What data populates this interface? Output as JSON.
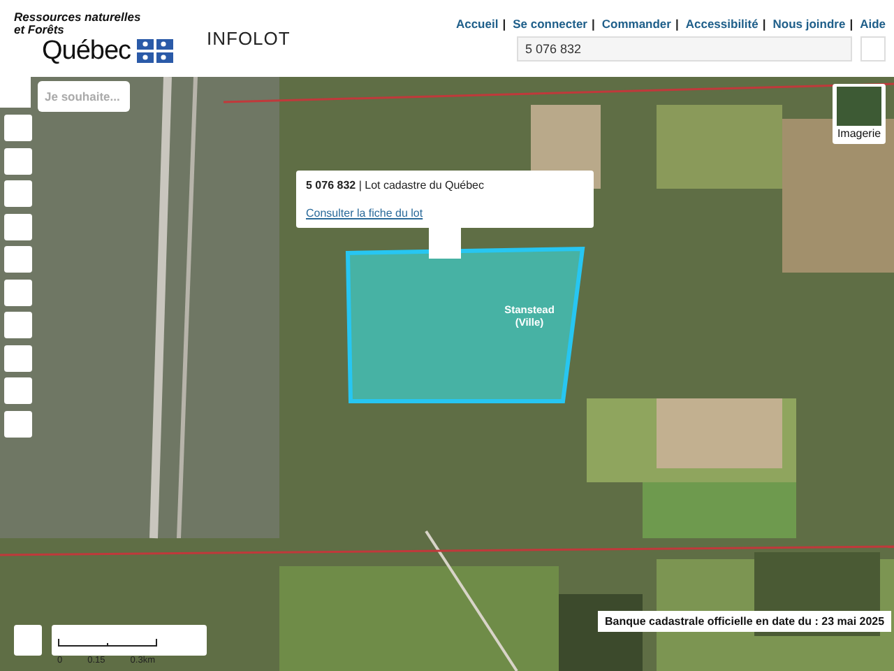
{
  "header": {
    "logo": {
      "ministry": [
        "Ressources naturelles",
        "et Forêts"
      ],
      "wordmark": "Québec"
    },
    "app_title": "INFOLOT",
    "separator": "|",
    "nav_links": [
      "Accueil",
      "Se connecter",
      "Commander",
      "Accessibilité",
      "Nous joindre",
      "Aide"
    ],
    "search": {
      "value": "5 076 832"
    }
  },
  "map": {
    "prompt": {
      "placeholder": "Je souhaite..."
    },
    "imagery": {
      "label": "Imagerie"
    },
    "popup": {
      "heading": "**5 076 832** | Lot cadastre du Québec",
      "link": "Consulter la fiche du lot"
    },
    "lot_label": [
      "Stanstead",
      "(Ville)"
    ],
    "scale": {
      "ticks": [
        "0",
        "0.15",
        "0.3km"
      ]
    },
    "banner": "Banque cadastrale officielle en date du : 23 mai 2025"
  }
}
